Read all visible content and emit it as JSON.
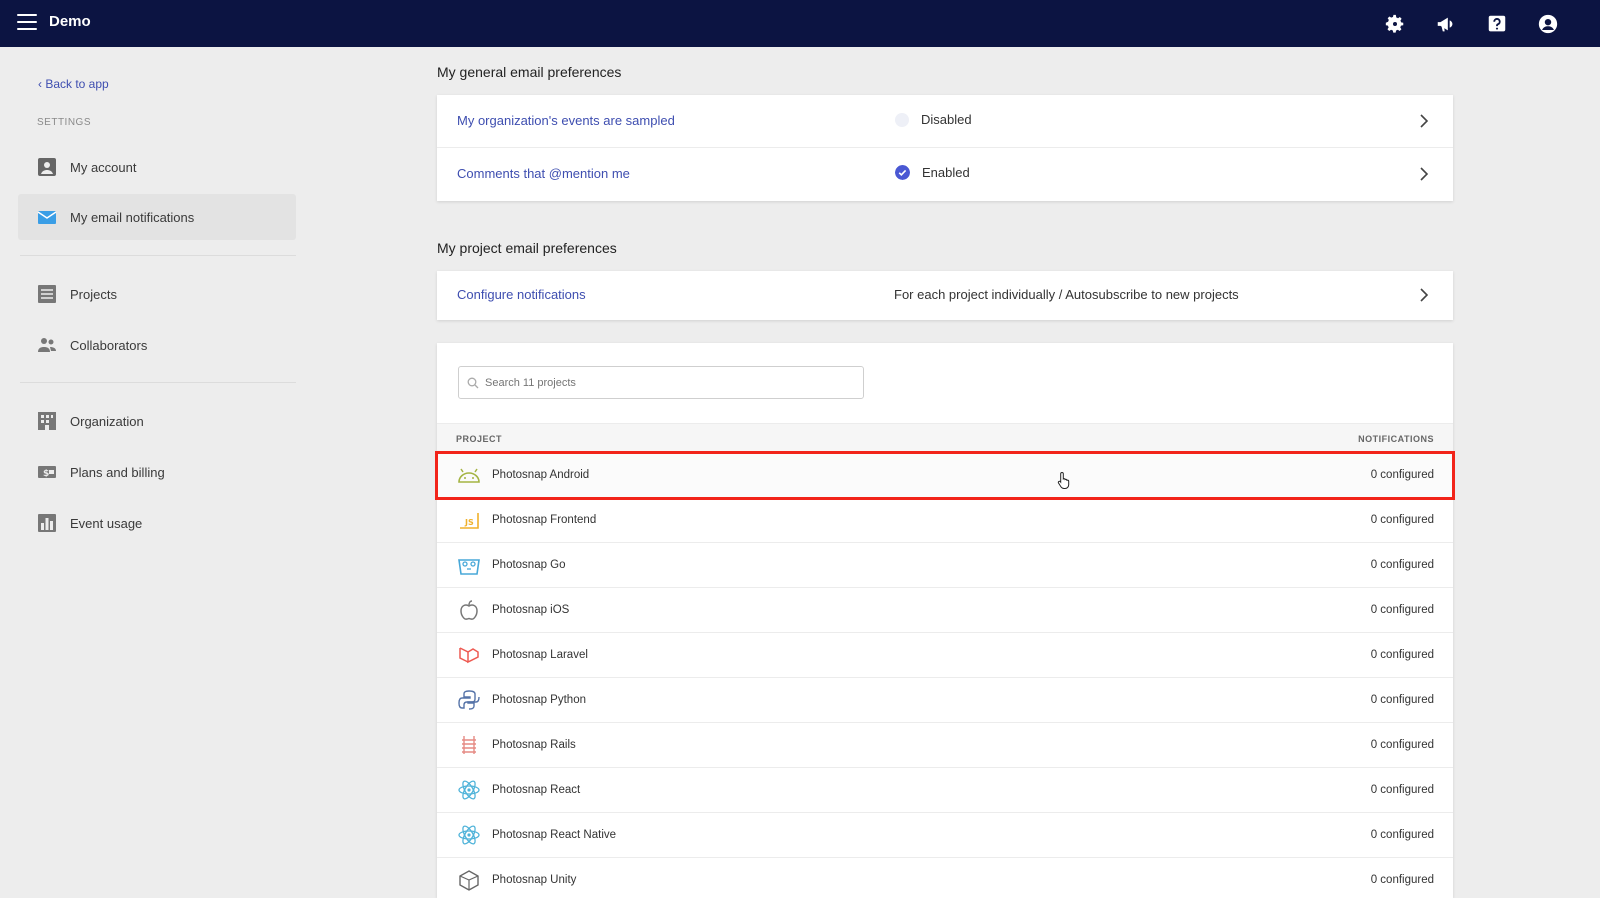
{
  "app": {
    "title": "Demo"
  },
  "topbar": {
    "icons": [
      "gear-icon",
      "megaphone-icon",
      "help-icon",
      "user-icon"
    ]
  },
  "sidebar": {
    "back_link": "‹ Back to app",
    "section_label": "SETTINGS",
    "items": [
      {
        "label": "My account",
        "icon": "account-icon"
      },
      {
        "label": "My email notifications",
        "icon": "email-icon",
        "active": true
      },
      {
        "label": "Projects",
        "icon": "projects-icon"
      },
      {
        "label": "Collaborators",
        "icon": "collaborators-icon"
      },
      {
        "label": "Organization",
        "icon": "organization-icon"
      },
      {
        "label": "Plans and billing",
        "icon": "billing-icon"
      },
      {
        "label": "Event usage",
        "icon": "usage-icon"
      }
    ]
  },
  "general": {
    "title": "My general email preferences",
    "rows": [
      {
        "label": "My organization's events are sampled",
        "status": "Disabled"
      },
      {
        "label": "Comments that @mention me",
        "status": "Enabled"
      }
    ]
  },
  "project": {
    "title": "My project email preferences",
    "configure": {
      "label": "Configure notifications",
      "value": "For each project individually / Autosubscribe to new projects"
    },
    "search_placeholder": "Search 11 projects",
    "columns": {
      "project": "PROJECT",
      "notifications": "NOTIFICATIONS"
    },
    "rows": [
      {
        "name": "Photosnap Android",
        "count": "0 configured",
        "icon": "android-icon"
      },
      {
        "name": "Photosnap Frontend",
        "count": "0 configured",
        "icon": "javascript-icon"
      },
      {
        "name": "Photosnap Go",
        "count": "0 configured",
        "icon": "go-icon"
      },
      {
        "name": "Photosnap iOS",
        "count": "0 configured",
        "icon": "apple-icon"
      },
      {
        "name": "Photosnap Laravel",
        "count": "0 configured",
        "icon": "laravel-icon"
      },
      {
        "name": "Photosnap Python",
        "count": "0 configured",
        "icon": "python-icon"
      },
      {
        "name": "Photosnap Rails",
        "count": "0 configured",
        "icon": "rails-icon"
      },
      {
        "name": "Photosnap React",
        "count": "0 configured",
        "icon": "react-icon"
      },
      {
        "name": "Photosnap React Native",
        "count": "0 configured",
        "icon": "react-icon"
      },
      {
        "name": "Photosnap Unity",
        "count": "0 configured",
        "icon": "unity-icon"
      }
    ]
  },
  "colors": {
    "topbar": "#0c1442",
    "link": "#3e4eb0",
    "highlight": "#f2241a",
    "enabled": "#4a58d3"
  }
}
